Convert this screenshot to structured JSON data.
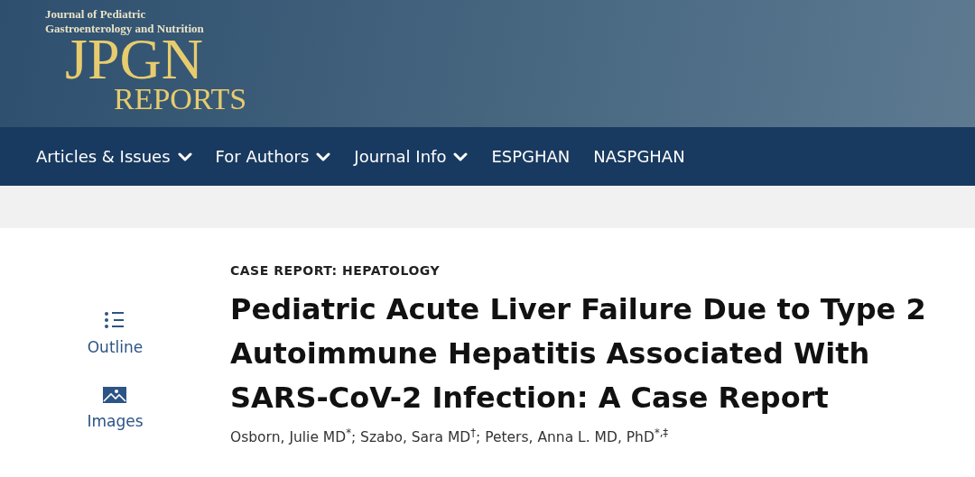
{
  "logo": {
    "line_1": "Journal of Pediatric",
    "line_2": "Gastroenterology and Nutrition",
    "title": "JPGN",
    "subtitle": "REPORTS"
  },
  "nav": [
    {
      "label": "Articles & Issues",
      "has_menu": true
    },
    {
      "label": "For Authors",
      "has_menu": true
    },
    {
      "label": "Journal Info",
      "has_menu": true
    },
    {
      "label": "ESPGHAN",
      "has_menu": false
    },
    {
      "label": "NASPGHAN",
      "has_menu": false
    }
  ],
  "tools": [
    {
      "kind": "outline",
      "label": "Outline"
    },
    {
      "kind": "images",
      "label": "Images"
    }
  ],
  "article": {
    "category": "CASE REPORT: HEPATOLOGY",
    "title": "Pediatric Acute Liver Failure Due to Type 2 Autoimmune Hepatitis Associated With SARS-CoV-2 Infection: A Case Report",
    "authors": "Osborn, Julie MD$^{*}$; Szabo, Sara MD$^{†}$; Peters, Anna L. MD, PhD$^{*,‡}$"
  }
}
